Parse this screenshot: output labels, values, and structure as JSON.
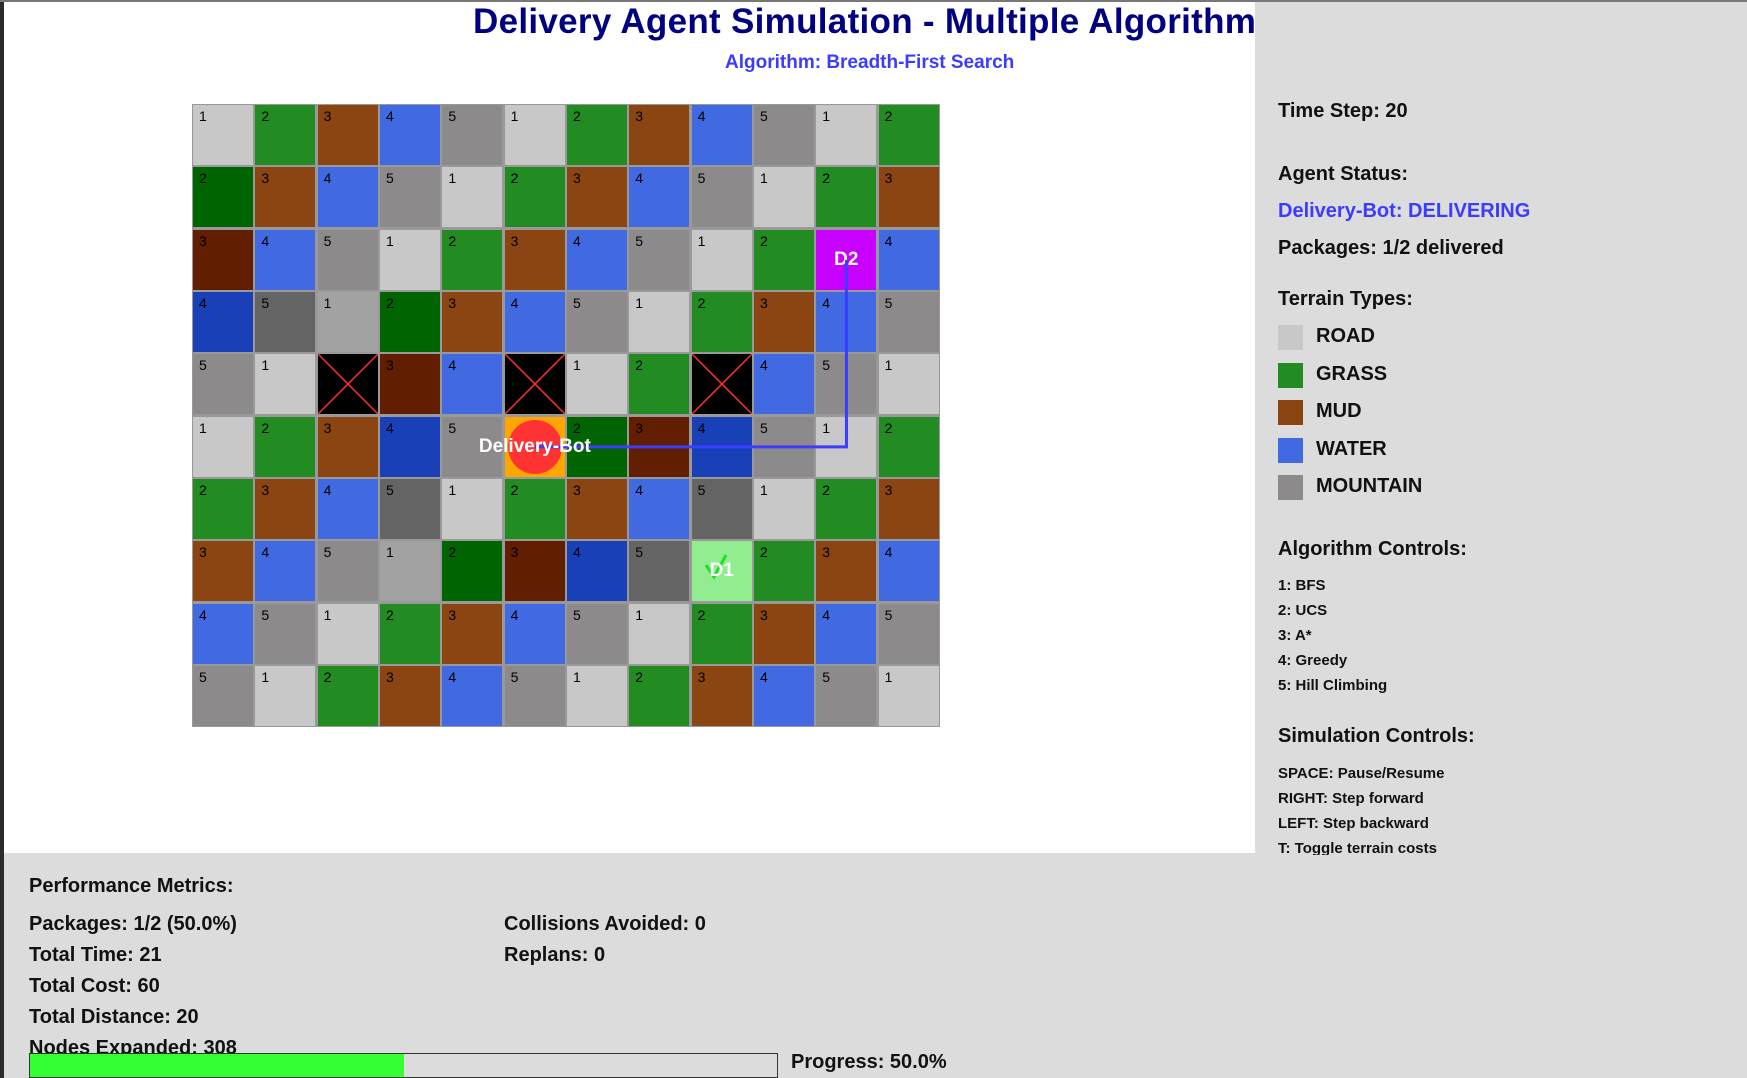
{
  "header": {
    "title": "Delivery Agent Simulation - Multiple Algorithms",
    "subtitle": "Algorithm: Breadth-First Search"
  },
  "colors": {
    "1": "#c8c8c8",
    "1d": "#a2a2a2",
    "2": "#228b22",
    "2d": "#006400",
    "3": "#8b4513",
    "3d": "#621e00",
    "4": "#4169e1",
    "4d": "#1a40b8",
    "5": "#8c8a8a",
    "5d": "#646464",
    "X": "#000000",
    "A": "#ffa500",
    "D1": "#90ee90",
    "D2": "#c800ff",
    "path": "#3c3cff",
    "agent": "#ff3333",
    "check": "#22dd22"
  },
  "grid": [
    [
      "1",
      "2",
      "3",
      "4",
      "5",
      "1",
      "2",
      "3",
      "4",
      "5",
      "1",
      "2"
    ],
    [
      "2d",
      "3",
      "4",
      "5",
      "1",
      "2",
      "3",
      "4",
      "5",
      "1",
      "2",
      "3"
    ],
    [
      "3d",
      "4",
      "5",
      "1",
      "2",
      "3",
      "4",
      "5",
      "1",
      "2",
      "D2",
      "4"
    ],
    [
      "4d",
      "5d",
      "1d",
      "2d",
      "3",
      "4",
      "5",
      "1",
      "2",
      "3",
      "4",
      "5"
    ],
    [
      "5",
      "1",
      "X",
      "3d",
      "4",
      "X",
      "1",
      "2",
      "X",
      "4",
      "5",
      "1"
    ],
    [
      "1",
      "2",
      "3",
      "4d",
      "5",
      "A",
      "2d",
      "3d",
      "4d",
      "5",
      "1",
      "2"
    ],
    [
      "2",
      "3",
      "4",
      "5d",
      "1",
      "2",
      "3",
      "4",
      "5d",
      "1",
      "2",
      "3"
    ],
    [
      "3",
      "4",
      "5",
      "1d",
      "2d",
      "3d",
      "4d",
      "5d",
      "D1",
      "2",
      "3",
      "4"
    ],
    [
      "4",
      "5",
      "1",
      "2",
      "3",
      "4",
      "5",
      "1",
      "2",
      "3",
      "4",
      "5"
    ],
    [
      "5",
      "1",
      "2",
      "3",
      "4",
      "5",
      "1",
      "2",
      "3",
      "4",
      "5",
      "1"
    ]
  ],
  "agent": {
    "name": "Delivery-Bot",
    "row": 5,
    "col": 5
  },
  "path": [
    [
      5,
      5
    ],
    [
      5,
      10
    ],
    [
      2,
      10
    ]
  ],
  "destinations": [
    {
      "label": "D1",
      "delivered": true
    },
    {
      "label": "D2",
      "delivered": false
    }
  ],
  "sidebar": {
    "time_step": "Time Step: 20",
    "agent_status_heading": "Agent Status:",
    "agent_status": "Delivery-Bot: DELIVERING",
    "packages": "Packages: 1/2 delivered",
    "terrain_heading": "Terrain Types:",
    "terrain": [
      {
        "label": "ROAD",
        "color": "#c8c8c8"
      },
      {
        "label": "GRASS",
        "color": "#228b22"
      },
      {
        "label": "MUD",
        "color": "#8b4513"
      },
      {
        "label": "WATER",
        "color": "#4169e1"
      },
      {
        "label": "MOUNTAIN",
        "color": "#8c8a8a"
      }
    ],
    "algo_heading": "Algorithm Controls:",
    "algos": [
      "1: BFS",
      "2: UCS",
      "3: A*",
      "4: Greedy",
      "5: Hill Climbing"
    ],
    "sim_heading": "Simulation Controls:",
    "sim": [
      "SPACE: Pause/Resume",
      "RIGHT: Step forward",
      "LEFT: Step backward",
      "T: Toggle terrain costs"
    ]
  },
  "metrics": {
    "heading": "Performance Metrics:",
    "packages": "Packages: 1/2 (50.0%)",
    "total_time": "Total Time: 21",
    "total_cost": "Total Cost: 60",
    "total_distance": "Total Distance: 20",
    "nodes_expanded": "Nodes Expanded: 308",
    "collisions": "Collisions Avoided: 0",
    "replans": "Replans: 0",
    "progress_label": "Progress: 50.0%",
    "progress": 0.5
  }
}
